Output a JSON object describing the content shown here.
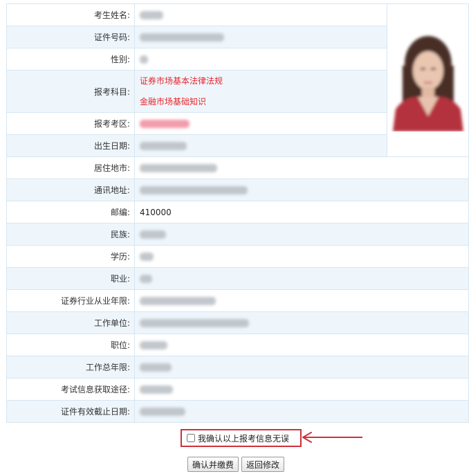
{
  "form": {
    "rows": [
      {
        "label": "考生姓名:"
      },
      {
        "label": "证件号码:"
      },
      {
        "label": "性别:"
      },
      {
        "label": "报考科目:",
        "subjects": [
          "证券市场基本法律法规",
          "金融市场基础知识"
        ]
      },
      {
        "label": "报考考区:"
      },
      {
        "label": "出生日期:"
      },
      {
        "label": "居住地市:"
      },
      {
        "label": "通讯地址:"
      },
      {
        "label": "邮编:",
        "value": "410000"
      },
      {
        "label": "民族:"
      },
      {
        "label": "学历:"
      },
      {
        "label": "职业:"
      },
      {
        "label": "证券行业从业年限:"
      },
      {
        "label": "工作单位:"
      },
      {
        "label": "职位:"
      },
      {
        "label": "工作总年限:"
      },
      {
        "label": "考试信息获取途径:"
      },
      {
        "label": "证件有效截止日期:"
      }
    ]
  },
  "confirm": {
    "checkbox_label": "我确认以上报考信息无误"
  },
  "buttons": {
    "confirm_pay": "确认并缴费",
    "back_edit": "返回修改"
  },
  "colors": {
    "border": "#d6e6f2",
    "row_alt": "#eef6fc",
    "subject_red": "#e8262c",
    "highlight_box": "#d0303a"
  }
}
